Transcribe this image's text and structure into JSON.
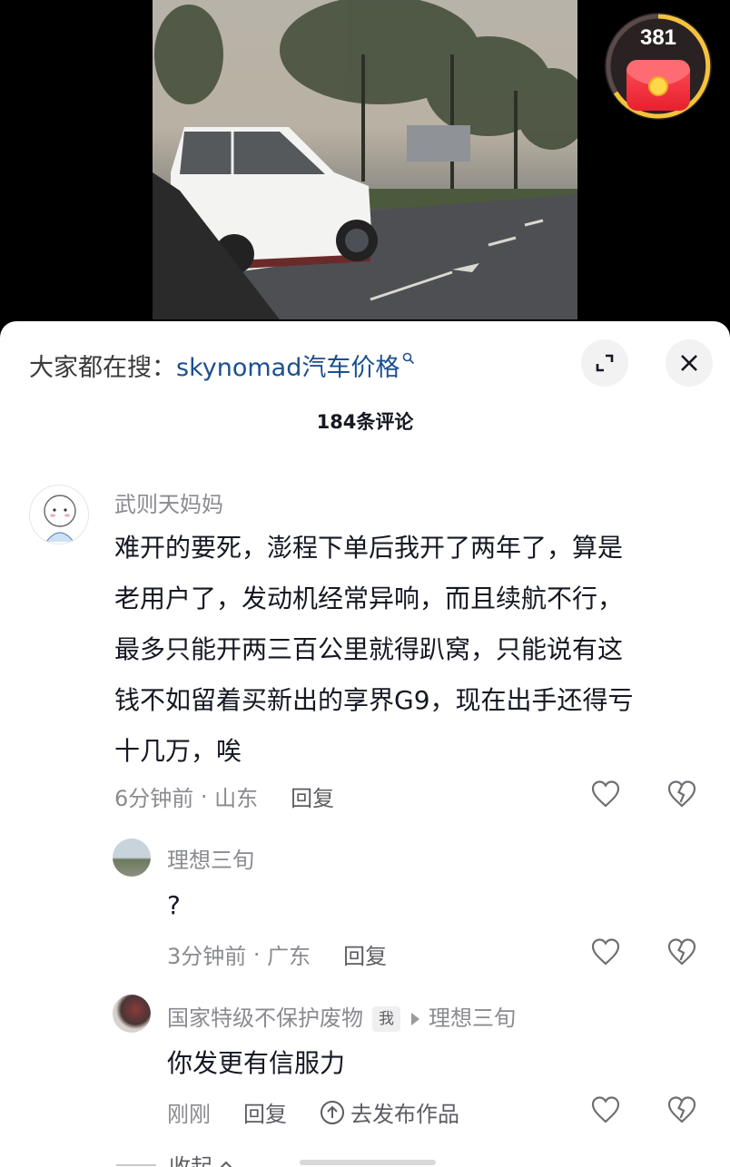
{
  "badge": {
    "count": "381"
  },
  "search": {
    "prefix": "大家都在搜：",
    "term": "skynomad汽车价格"
  },
  "comments_header": {
    "count_label": "184条评论"
  },
  "comments": [
    {
      "author": "武则天妈妈",
      "lines": [
        "难开的要死，澎程下单后我开了两年了，算是",
        "老用户了，发动机经常异响，而且续航不行，",
        "最多只能开两三百公里就得趴窝，只能说有这",
        "钱不如留着买新出的享界G9，现在出手还得亏",
        "十几万，唉"
      ],
      "time": "6分钟前",
      "location": "山东",
      "reply_label": "回复"
    },
    {
      "author": "理想三旬",
      "text": "?",
      "time": "3分钟前",
      "location": "广东",
      "reply_label": "回复"
    },
    {
      "author": "国家特级不保护废物",
      "me_tag": "我",
      "reply_to": "理想三旬",
      "text": "你发更有信服力",
      "time": "刚刚",
      "reply_label": "回复",
      "publish_label": "去发布作品"
    }
  ],
  "footer": {
    "collapse_label": "收起"
  },
  "colors": {
    "link": "#1c4f8f",
    "muted": "#8a8b91",
    "text": "#161823",
    "badge_red": "#e7202e"
  }
}
